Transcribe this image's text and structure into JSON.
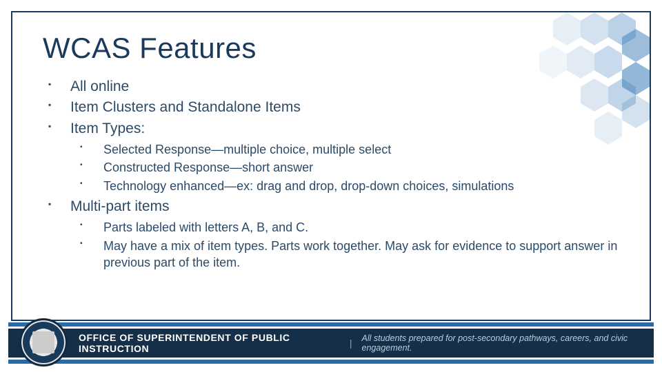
{
  "title": "WCAS Features",
  "bullets": {
    "b0": "All online",
    "b1": "Item Clusters and Standalone Items",
    "b2": "Item Types:",
    "b2_sub": {
      "s0": "Selected Response—multiple choice, multiple select",
      "s1": "Constructed Response—short answer",
      "s2": "Technology enhanced—ex: drag and drop, drop-down choices, simulations"
    },
    "b3": "Multi-part items",
    "b3_sub": {
      "s0": "Parts labeled with letters A, B, and C.",
      "s1": "May have a mix of item types. Parts work together. May ask for evidence to support answer in previous part of the item."
    }
  },
  "footer": {
    "office": "OFFICE OF SUPERINTENDENT OF PUBLIC INSTRUCTION",
    "divider": "|",
    "tagline": "All students prepared for post-secondary pathways, careers, and civic engagement."
  }
}
